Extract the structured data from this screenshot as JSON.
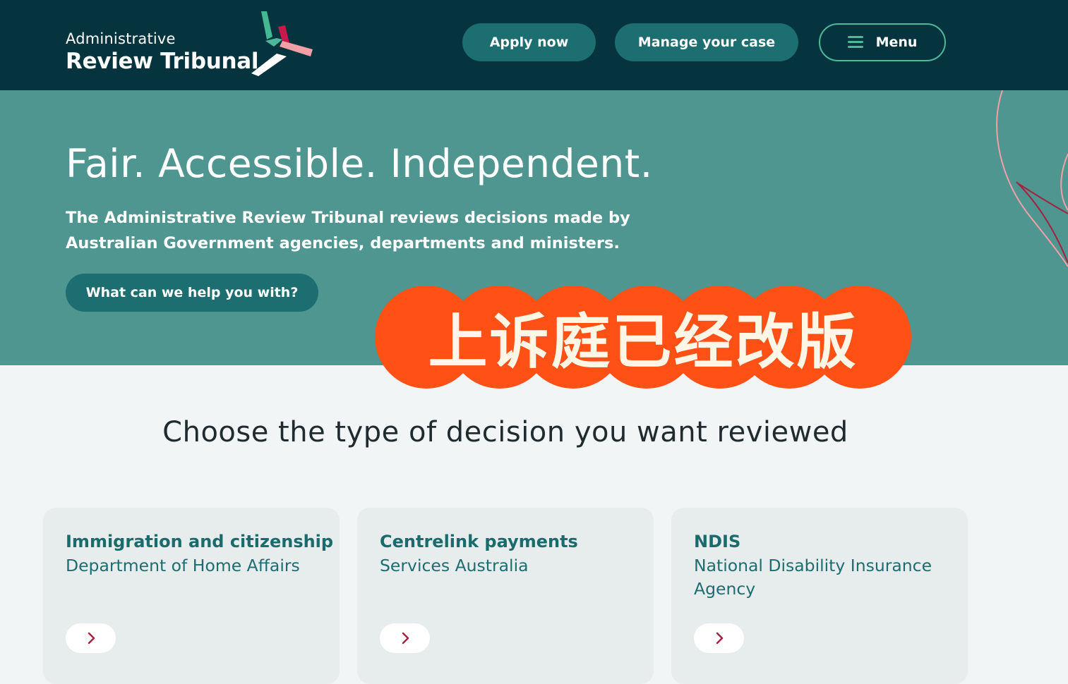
{
  "header": {
    "logo_line1": "Administrative",
    "logo_line2": "Review Tribunal",
    "apply_label": "Apply now",
    "manage_label": "Manage your case",
    "menu_label": "Menu"
  },
  "hero": {
    "title": "Fair. Accessible. Independent.",
    "description": "The Administrative Review Tribunal reviews decisions made by Australian Government agencies, departments and ministers.",
    "cta_label": "What can we help you with?"
  },
  "overlay": {
    "text": "上诉庭已经改版"
  },
  "decisions": {
    "heading": "Choose the type of decision you want reviewed",
    "cards": [
      {
        "title": "Immigration and citizenship",
        "subtitle": "Department of Home Affairs"
      },
      {
        "title": "Centrelink payments",
        "subtitle": "Services Australia"
      },
      {
        "title": "NDIS",
        "subtitle": "National Disability Insurance Agency"
      }
    ]
  },
  "colors": {
    "header_bg": "#05343f",
    "hero_bg": "#4f9690",
    "button_bg": "#1d6e70",
    "menu_border": "#4eb89a",
    "card_bg": "#e7eced",
    "card_title": "#1a6b6c",
    "overlay_bg": "#ff5016",
    "arrow_color": "#a3223f"
  },
  "icons": {
    "menu": "hamburger-icon",
    "card_arrow": "chevron-right-icon",
    "logo": "art-logo-mark"
  }
}
